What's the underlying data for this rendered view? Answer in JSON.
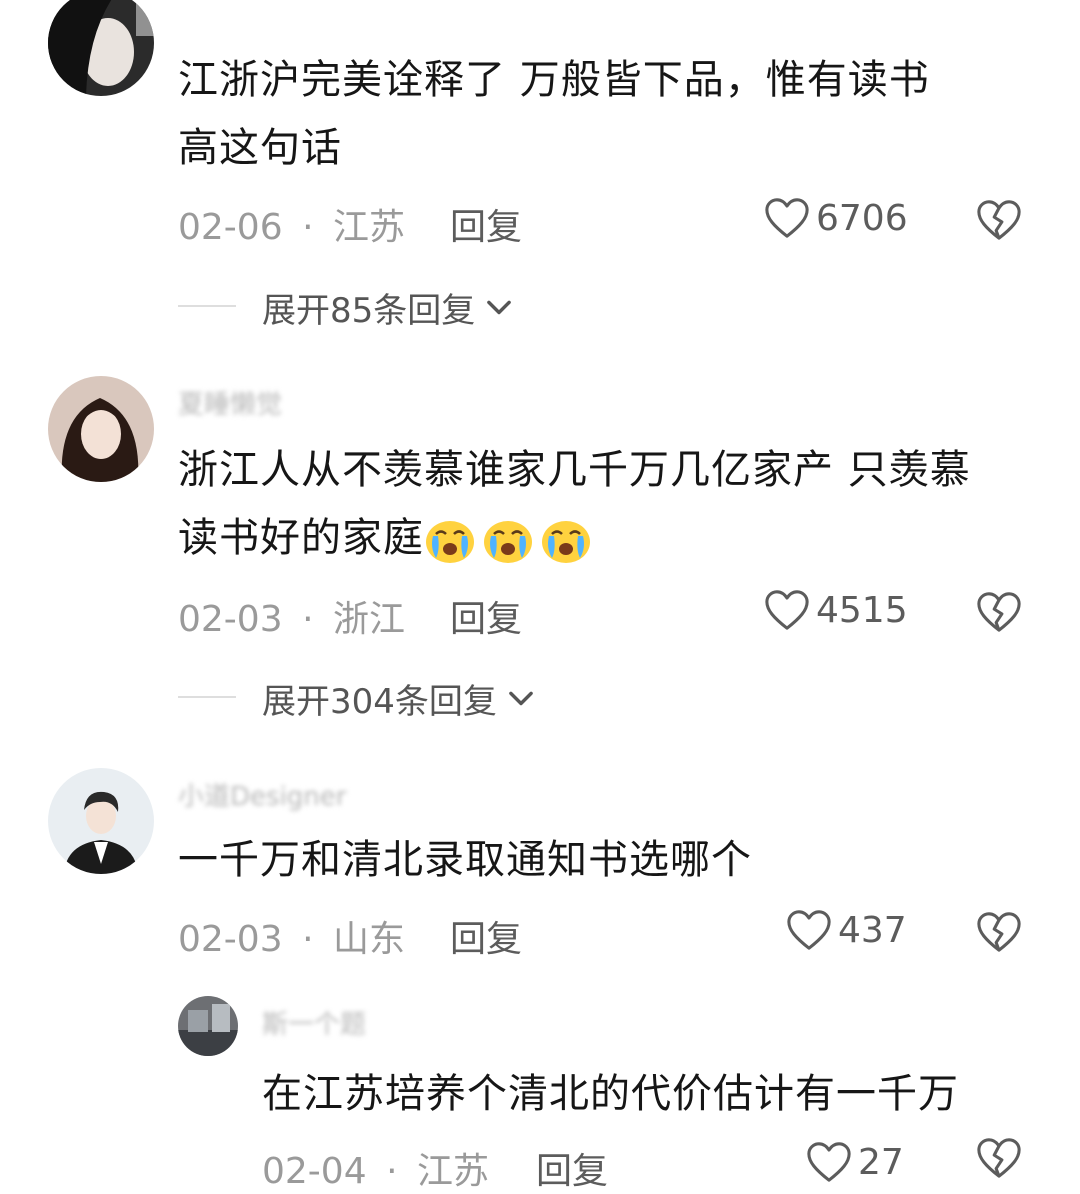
{
  "comments": [
    {
      "username": "",
      "text": "江浙沪完美诠释了  万般皆下品，惟有读书高这句话",
      "line1": "江浙沪完美诠释了  万般皆下品，惟有读书",
      "line2": "高这句话",
      "date": "02-06",
      "location": "江苏",
      "reply_label": "回复",
      "likes": "6706",
      "expand_label": "展开85条回复"
    },
    {
      "username": "夏睡懒觉",
      "line1": "浙江人从不羡慕谁家几千万几亿家产 只羡慕",
      "line2": "读书好的家庭",
      "emojis": [
        "crying-face",
        "crying-face",
        "crying-face"
      ],
      "date": "02-03",
      "location": "浙江",
      "reply_label": "回复",
      "likes": "4515",
      "expand_label": "展开304条回复"
    },
    {
      "username": "小道Designer",
      "line1": "一千万和清北录取通知书选哪个",
      "date": "02-03",
      "location": "山东",
      "reply_label": "回复",
      "likes": "437"
    }
  ],
  "reply": {
    "username": "斯一个题",
    "text": "在江苏培养个清北的代价估计有一千万",
    "date": "02-04",
    "location": "江苏",
    "reply_label": "回复",
    "likes": "27"
  },
  "separator": "·",
  "colors": {
    "text": "#161616",
    "meta": "#9a9a9a",
    "action": "#5c5c5c"
  },
  "icons": [
    "heart-icon",
    "broken-heart-icon",
    "chevron-down-icon"
  ]
}
